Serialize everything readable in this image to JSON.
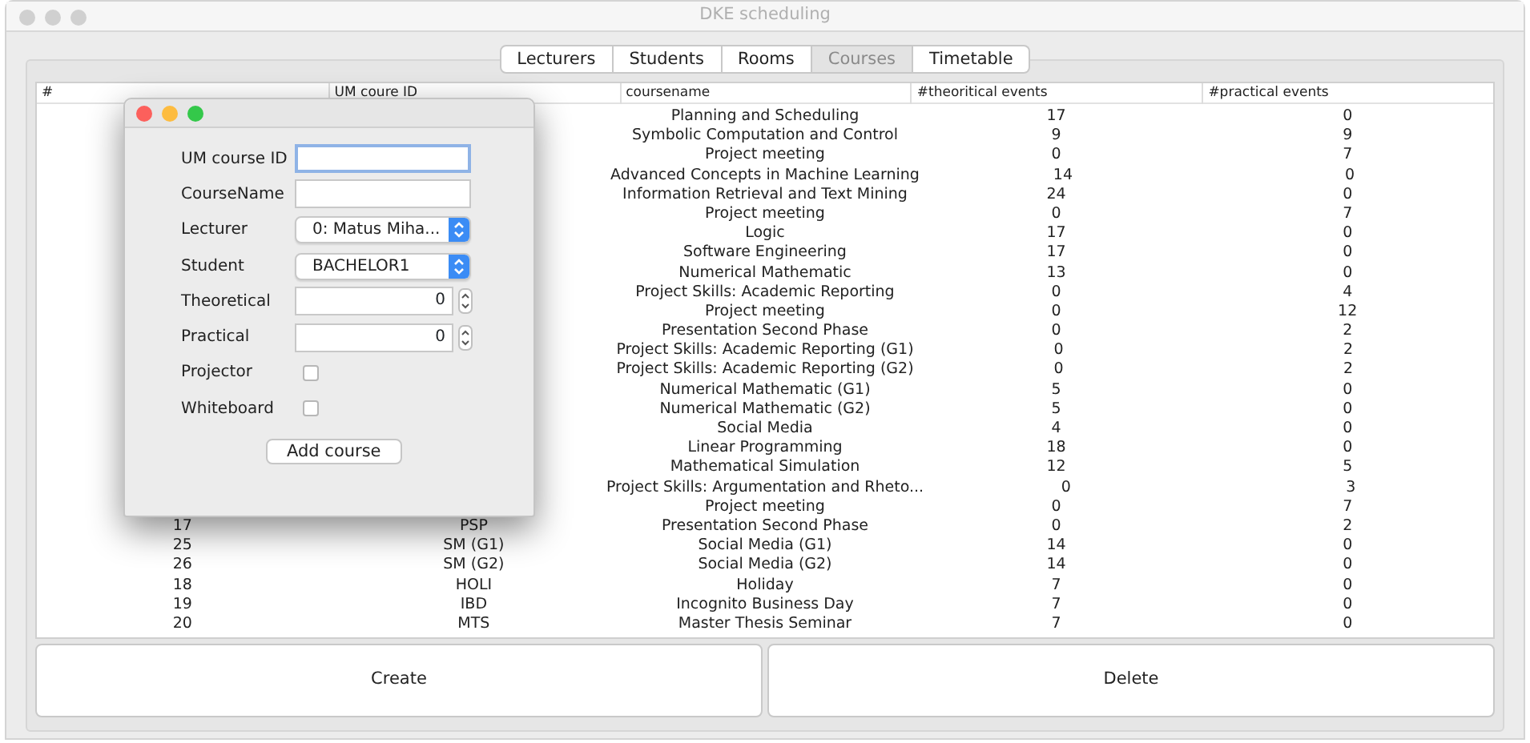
{
  "window": {
    "title": "DKE scheduling"
  },
  "tabs": [
    {
      "label": "Lecturers",
      "selected": false
    },
    {
      "label": "Students",
      "selected": false
    },
    {
      "label": "Rooms",
      "selected": false
    },
    {
      "label": "Courses",
      "selected": true
    },
    {
      "label": "Timetable",
      "selected": false
    }
  ],
  "table": {
    "columns": [
      "#",
      "UM coure ID",
      "coursename",
      "#theoritical events",
      "#practical events"
    ],
    "rows": [
      {
        "name": "Planning and Scheduling",
        "theoretical": "17",
        "practical": "0"
      },
      {
        "name": "Symbolic Computation and Control",
        "theoretical": "9",
        "practical": "9"
      },
      {
        "name": "Project meeting",
        "theoretical": "0",
        "practical": "7"
      },
      {
        "name": "Advanced Concepts in Machine Learning",
        "theoretical": "14",
        "practical": "0"
      },
      {
        "name": "Information Retrieval and Text Mining",
        "theoretical": "24",
        "practical": "0"
      },
      {
        "name": "Project meeting",
        "theoretical": "0",
        "practical": "7"
      },
      {
        "name": "Logic",
        "theoretical": "17",
        "practical": "0"
      },
      {
        "name": "Software Engineering",
        "theoretical": "17",
        "practical": "0"
      },
      {
        "name": "Numerical Mathematic",
        "theoretical": "13",
        "practical": "0"
      },
      {
        "name": "Project Skills: Academic Reporting",
        "theoretical": "0",
        "practical": "4"
      },
      {
        "name": "Project meeting",
        "theoretical": "0",
        "practical": "12"
      },
      {
        "name": "Presentation Second Phase",
        "theoretical": "0",
        "practical": "2"
      },
      {
        "name": "Project Skills: Academic Reporting (G1)",
        "theoretical": "0",
        "practical": "2"
      },
      {
        "name": "Project Skills: Academic Reporting (G2)",
        "theoretical": "0",
        "practical": "2"
      },
      {
        "name": "Numerical Mathematic (G1)",
        "theoretical": "5",
        "practical": "0"
      },
      {
        "name": "Numerical Mathematic (G2)",
        "theoretical": "5",
        "practical": "0"
      },
      {
        "name": "Social Media",
        "theoretical": "4",
        "practical": "0"
      },
      {
        "name": "Linear Programming",
        "theoretical": "18",
        "practical": "0"
      },
      {
        "name": "Mathematical Simulation",
        "theoretical": "12",
        "practical": "5"
      },
      {
        "name": "Project Skills: Argumentation and Rheto...",
        "theoretical": "0",
        "practical": "3"
      },
      {
        "name": "Project meeting",
        "theoretical": "0",
        "practical": "7"
      },
      {
        "number": "17",
        "id": "PSP",
        "name": "Presentation Second Phase",
        "theoretical": "0",
        "practical": "2"
      },
      {
        "number": "25",
        "id": "SM (G1)",
        "name": "Social Media (G1)",
        "theoretical": "14",
        "practical": "0"
      },
      {
        "number": "26",
        "id": "SM (G2)",
        "name": "Social Media (G2)",
        "theoretical": "14",
        "practical": "0"
      },
      {
        "number": "18",
        "id": "HOLI",
        "name": "Holiday",
        "theoretical": "7",
        "practical": "0"
      },
      {
        "number": "19",
        "id": "IBD",
        "name": "Incognito Business Day",
        "theoretical": "7",
        "practical": "0"
      },
      {
        "number": "20",
        "id": "MTS",
        "name": "Master Thesis Seminar",
        "theoretical": "7",
        "practical": "0"
      }
    ]
  },
  "buttons": [
    "Create",
    "Delete"
  ],
  "dialog": {
    "fields": [
      {
        "kind": "text",
        "label": "UM course ID",
        "focused": true
      },
      {
        "kind": "text",
        "label": "CourseName",
        "focused": false
      },
      {
        "kind": "combo",
        "label": "Lecturer",
        "value": "0: Matus Miha..."
      },
      {
        "kind": "combo",
        "label": "Student",
        "value": "BACHELOR1"
      },
      {
        "kind": "spinner",
        "label": "Theoretical",
        "value": "0"
      },
      {
        "kind": "spinner",
        "label": "Practical",
        "value": "0"
      },
      {
        "kind": "checkbox",
        "label": "Projector",
        "checked": false
      },
      {
        "kind": "checkbox",
        "label": "Whiteboard",
        "checked": false
      }
    ],
    "button": "Add course"
  }
}
